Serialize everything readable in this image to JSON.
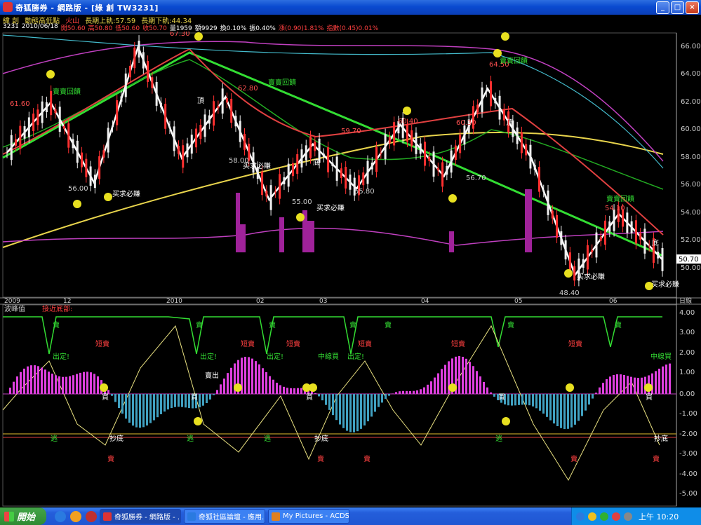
{
  "window": {
    "title": "奇狐勝券 - 網路版 - [綠  創 TW3231]",
    "buttons": [
      "_",
      "□",
      "×"
    ]
  },
  "header": {
    "name": "緯  創",
    "indicator_label": "動態高低點",
    "status1": "火山",
    "long_up": "長期上軌:57.59",
    "long_down": "長期下軌:44.34"
  },
  "quote": {
    "code": "3231",
    "date": "2010/06/18",
    "open": "開50.60",
    "high": "高50.80",
    "low": "低50.60",
    "close": "收50.70",
    "volume": "量1959",
    "amount": "額9929",
    "turnover": "換0.10%",
    "amplitude": "振0.40%",
    "change": "漲(0.90)1.81%",
    "index": "指數(0.45)0.01%"
  },
  "main_axis": {
    "ticks": [
      "66.00",
      "64.00",
      "62.00",
      "60.00",
      "58.00",
      "56.00",
      "54.00",
      "52.00",
      "50.00"
    ],
    "current": "50.70"
  },
  "date_axis": {
    "labels": [
      "2009",
      "12",
      "2010",
      "02",
      "03",
      "04",
      "05",
      "06"
    ],
    "right_label": "日線"
  },
  "lower_panel": {
    "title": "波峰值",
    "subtitle": "接近底部:",
    "ticks": [
      "4.00",
      "3.00",
      "2.00",
      "1.00",
      "0.00",
      "-1.00",
      "-2.00",
      "-3.00",
      "-4.00",
      "-5.00"
    ]
  },
  "price_labels": [
    "61.60",
    "67.30",
    "62.80",
    "64.50",
    "59.70",
    "60.40",
    "60.30",
    "58.00",
    "56.00",
    "55.00",
    "55.80",
    "56.70",
    "48.40",
    "54.10"
  ],
  "annotations": {
    "signal_buy": "賣賣回饋",
    "signal_must": "买求必賺",
    "top": "頂",
    "bottom": "底",
    "sell": "賣",
    "buy": "買",
    "short_sell": "短賣",
    "exit_confirm": "出定!",
    "mid_buy": "中線買",
    "escape": "逃",
    "bottom_fish": "抄底",
    "sell_out": "賣出"
  },
  "taskbar": {
    "start": "開始",
    "tasks": [
      "奇狐勝券 - 網路版 - ...",
      "奇狐社區論壇 - 應用...",
      "My Pictures - ACDSee..."
    ],
    "clock": "上午 10:20"
  },
  "chart_data": {
    "type": "candlestick",
    "series": [
      {
        "name": "price_wave",
        "values": [
          58.4,
          62.0,
          56.2,
          66.0,
          58.0,
          62.4,
          55.0,
          59.0,
          55.8,
          60.4,
          56.7,
          63.0,
          58.0,
          49.6,
          54.0,
          50.7
        ]
      }
    ],
    "ylim": [
      48,
      67
    ]
  }
}
